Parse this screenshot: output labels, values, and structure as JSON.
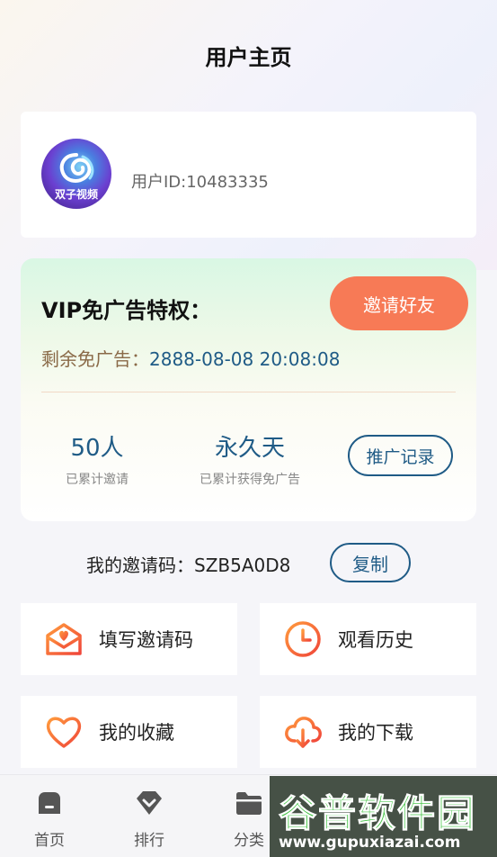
{
  "header": {
    "title": "用户主页"
  },
  "profile": {
    "avatar_text": "双子视频",
    "user_id": "用户ID:10483335"
  },
  "vip": {
    "title": "VIP免广告特权：",
    "invite_button": "邀请好友",
    "remaining_label": "剩余免广告：",
    "remaining_value": "2888-08-08 20:08:08",
    "stats": [
      {
        "value": "50人",
        "label": "已累计邀请"
      },
      {
        "value": "永久天",
        "label": "已累计获得免广告"
      }
    ],
    "record_button": "推广记录"
  },
  "invite_code": {
    "label": "我的邀请码：",
    "code": "SZB5A0D8",
    "copy_button": "复制"
  },
  "tiles": [
    {
      "label": "填写邀请码",
      "icon": "mail-heart-icon"
    },
    {
      "label": "观看历史",
      "icon": "clock-icon"
    },
    {
      "label": "我的收藏",
      "icon": "heart-icon"
    },
    {
      "label": "我的下载",
      "icon": "cloud-download-icon"
    }
  ],
  "tabbar": {
    "items": [
      {
        "label": "首页",
        "icon": "home-icon"
      },
      {
        "label": "排行",
        "icon": "diamond-icon"
      },
      {
        "label": "分类",
        "icon": "folder-icon"
      }
    ]
  },
  "watermark": {
    "text": "谷普软件园",
    "url": "www.gupuxiazai.com"
  },
  "colors": {
    "accent_orange": "#f77a56",
    "accent_blue": "#1f5b86",
    "remaining_label": "#8a6a48"
  }
}
